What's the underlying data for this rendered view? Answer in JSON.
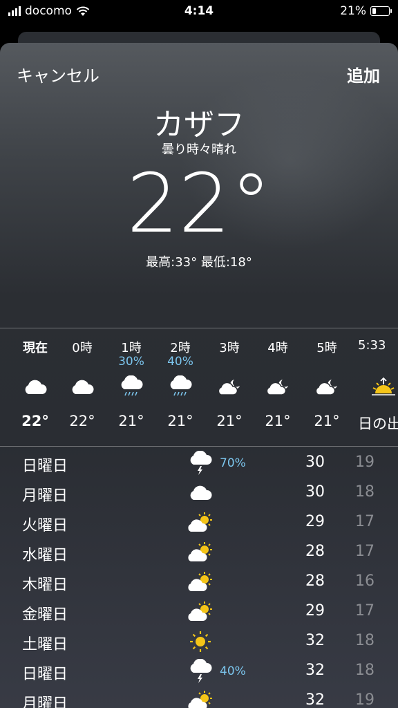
{
  "status_bar": {
    "carrier": "docomo",
    "time": "4:14",
    "battery": "21%"
  },
  "header": {
    "cancel_label": "キャンセル",
    "add_label": "追加"
  },
  "current": {
    "city": "カザフ",
    "condition": "曇り時々晴れ",
    "temperature": "22°",
    "high_low": "最高:33° 最低:18°"
  },
  "hourly": [
    {
      "time": "現在",
      "precip": "",
      "icon": "cloud-icon",
      "temp": "22°"
    },
    {
      "time": "0時",
      "precip": "",
      "icon": "cloud-icon",
      "temp": "22°"
    },
    {
      "time": "1時",
      "precip": "30%",
      "icon": "rain-cloud-icon",
      "temp": "21°"
    },
    {
      "time": "2時",
      "precip": "40%",
      "icon": "rain-cloud-icon",
      "temp": "21°"
    },
    {
      "time": "3時",
      "precip": "",
      "icon": "cloud-moon-icon",
      "temp": "21°"
    },
    {
      "time": "4時",
      "precip": "",
      "icon": "cloud-moon-icon",
      "temp": "21°"
    },
    {
      "time": "5時",
      "precip": "",
      "icon": "cloud-moon-icon",
      "temp": "21°"
    },
    {
      "time": "5:33",
      "precip": "",
      "icon": "sunrise-icon",
      "temp": "日の出"
    }
  ],
  "daily": [
    {
      "day": "日曜日",
      "icon": "thunder-cloud-icon",
      "precip": "70%",
      "high": "30",
      "low": "19"
    },
    {
      "day": "月曜日",
      "icon": "cloud-icon",
      "precip": "",
      "high": "30",
      "low": "18"
    },
    {
      "day": "火曜日",
      "icon": "partly-sunny-icon",
      "precip": "",
      "high": "29",
      "low": "17"
    },
    {
      "day": "水曜日",
      "icon": "partly-sunny-icon",
      "precip": "",
      "high": "28",
      "low": "17"
    },
    {
      "day": "木曜日",
      "icon": "partly-sunny-icon",
      "precip": "",
      "high": "28",
      "low": "16"
    },
    {
      "day": "金曜日",
      "icon": "partly-sunny-icon",
      "precip": "",
      "high": "29",
      "low": "17"
    },
    {
      "day": "土曜日",
      "icon": "sun-icon",
      "precip": "",
      "high": "32",
      "low": "18"
    },
    {
      "day": "日曜日",
      "icon": "thunder-cloud-icon",
      "precip": "40%",
      "high": "32",
      "low": "18"
    },
    {
      "day": "月曜日",
      "icon": "partly-sunny-icon",
      "precip": "",
      "high": "32",
      "low": "19"
    }
  ],
  "colors": {
    "precip": "#7cc6ee",
    "sun": "#f5c518",
    "low_temp": "#8b8d92"
  }
}
